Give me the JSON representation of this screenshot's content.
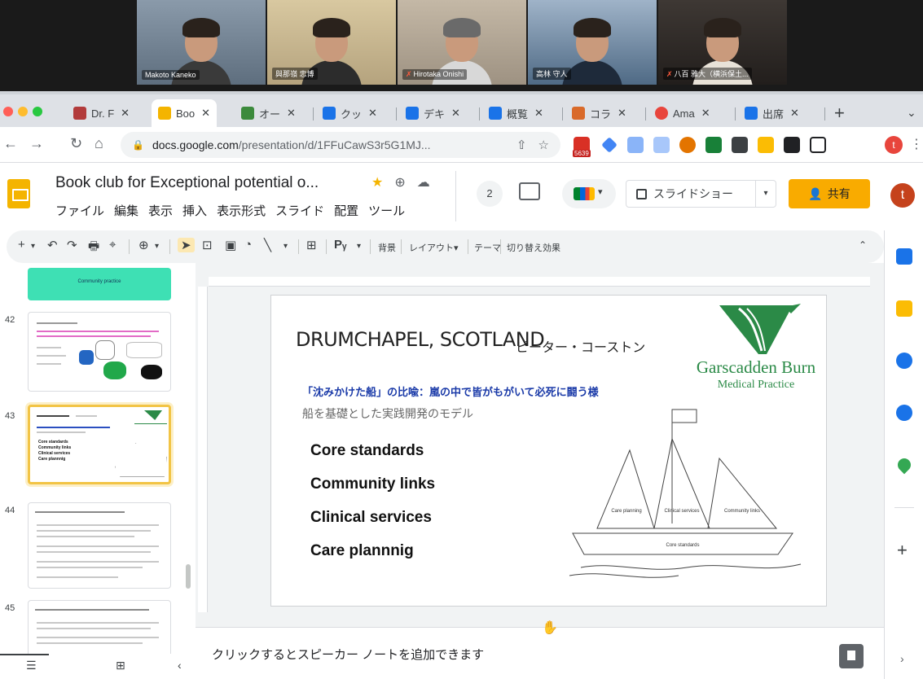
{
  "video_participants": [
    {
      "name": "Makoto Kaneko",
      "muted": false,
      "bg": "#7a8a9a"
    },
    {
      "name": "與那嶺 忠博",
      "muted": false,
      "bg": "#c9b78f"
    },
    {
      "name": "Hirotaka Onishi",
      "muted": true,
      "bg": "#b4aa9a"
    },
    {
      "name": "高林 守人",
      "muted": false,
      "bg": "#6d7f93"
    },
    {
      "name": "八百 雅大（横浜保土...",
      "muted": true,
      "bg": "#2e2a28"
    }
  ],
  "browser": {
    "tabs": [
      {
        "label": "Dr. F",
        "fav": "#b23b3b"
      },
      {
        "label": "Boo",
        "fav": "#f4b400",
        "active": true
      },
      {
        "label": "オー",
        "fav": "#3c8a3c"
      },
      {
        "label": "クッ",
        "fav": "#1a73e8"
      },
      {
        "label": "デキ",
        "fav": "#1a73e8"
      },
      {
        "label": "概覧",
        "fav": "#1a73e8"
      },
      {
        "label": "コラ",
        "fav": "#d96a2a"
      },
      {
        "label": "Ama",
        "fav": "#e8453c"
      },
      {
        "label": "出席",
        "fav": "#1a73e8"
      }
    ],
    "new_tab": "+",
    "url_host": "docs.google.com",
    "url_path": "/presentation/d/1FFuCawS3r5G1MJ...",
    "gmail_badge": "5639",
    "profile_initial": "t"
  },
  "slides_app": {
    "doc_title": "Book club for Exceptional potential o...",
    "menu": [
      "ファイル",
      "編集",
      "表示",
      "挿入",
      "表示形式",
      "スライド",
      "配置",
      "ツール"
    ],
    "viewers_count": "2",
    "slideshow_label": "スライドショー",
    "share_label": "共有",
    "avatar_initial": "t"
  },
  "toolbar": {
    "background_label": "背景",
    "layout_label": "レイアウト▾",
    "theme_label": "テーマ",
    "transition_label": "切り替え効果"
  },
  "filmstrip": {
    "slide_numbers": [
      "42",
      "43",
      "44",
      "45"
    ],
    "top_thumb_label": "Community practice",
    "thumb43_items": [
      "Core standards",
      "Community links",
      "Clinical services",
      "Care plannnig"
    ]
  },
  "slide": {
    "title": "DRUMCHAPEL, SCOTLAND",
    "presenter": "ピーター・コーストン",
    "quote": "「沈みかけた船」の比喩：嵐の中で皆がもがいて必死に闘う様",
    "subtitle": "船を基礎とした実践開発のモデル",
    "items": [
      "Core standards",
      "Community links",
      "Clinical services",
      "Care plannnig"
    ],
    "logo_line1": "Garscadden Burn",
    "logo_line2": "Medical Practice",
    "sail_labels": [
      "Care planning",
      "Clinical services",
      "Community links"
    ],
    "hull_label": "Core standards"
  },
  "notes": {
    "placeholder": "クリックするとスピーカー ノートを追加できます"
  },
  "colors": {
    "accent_yellow": "#f9ab00",
    "logo_green": "#2b8a47",
    "quote_blue": "#1a3aa8"
  }
}
